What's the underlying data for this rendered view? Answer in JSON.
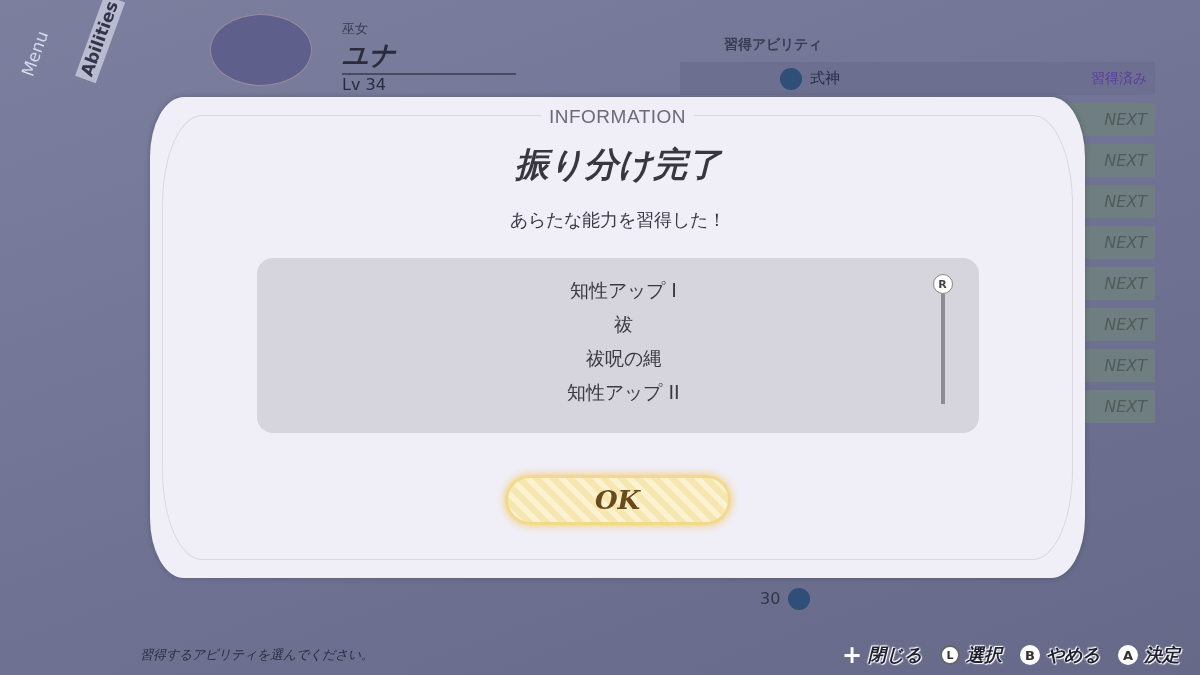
{
  "menu_tabs": [
    {
      "label": "Menu",
      "selected": false
    },
    {
      "label": "Abilities",
      "selected": true
    }
  ],
  "character": {
    "job": "巫女",
    "name": "ユナ",
    "level": "Lv 34"
  },
  "ability_panel": {
    "title": "習得アビリティ",
    "rows": [
      {
        "kind": "learned",
        "name": "式神",
        "status": "習得済み"
      },
      {
        "kind": "next",
        "status": "NEXT"
      },
      {
        "kind": "next",
        "status": "NEXT"
      },
      {
        "kind": "next",
        "status": "NEXT"
      },
      {
        "kind": "next",
        "status": "NEXT"
      },
      {
        "kind": "next",
        "status": "NEXT"
      },
      {
        "kind": "next",
        "status": "NEXT"
      },
      {
        "kind": "next",
        "status": "NEXT"
      },
      {
        "kind": "next",
        "status": "NEXT"
      },
      {
        "kind": "cost",
        "cost": "30"
      }
    ]
  },
  "hint": "習得するアビリティを選んでください。",
  "controls": [
    {
      "key": "+",
      "label": "閉じる",
      "kind": "plus"
    },
    {
      "key": "L",
      "label": "選択",
      "kind": "stick"
    },
    {
      "key": "B",
      "label": "やめる",
      "kind": "round"
    },
    {
      "key": "A",
      "label": "決定",
      "kind": "round"
    }
  ],
  "dialog": {
    "header": "INFORMATION",
    "title": "振り分け完了",
    "message": "あらたな能力を習得した！",
    "items": [
      "知性アップ I",
      "祓",
      "祓呪の縄",
      "知性アップ II"
    ],
    "scroll_key": "R",
    "button": "OK"
  }
}
